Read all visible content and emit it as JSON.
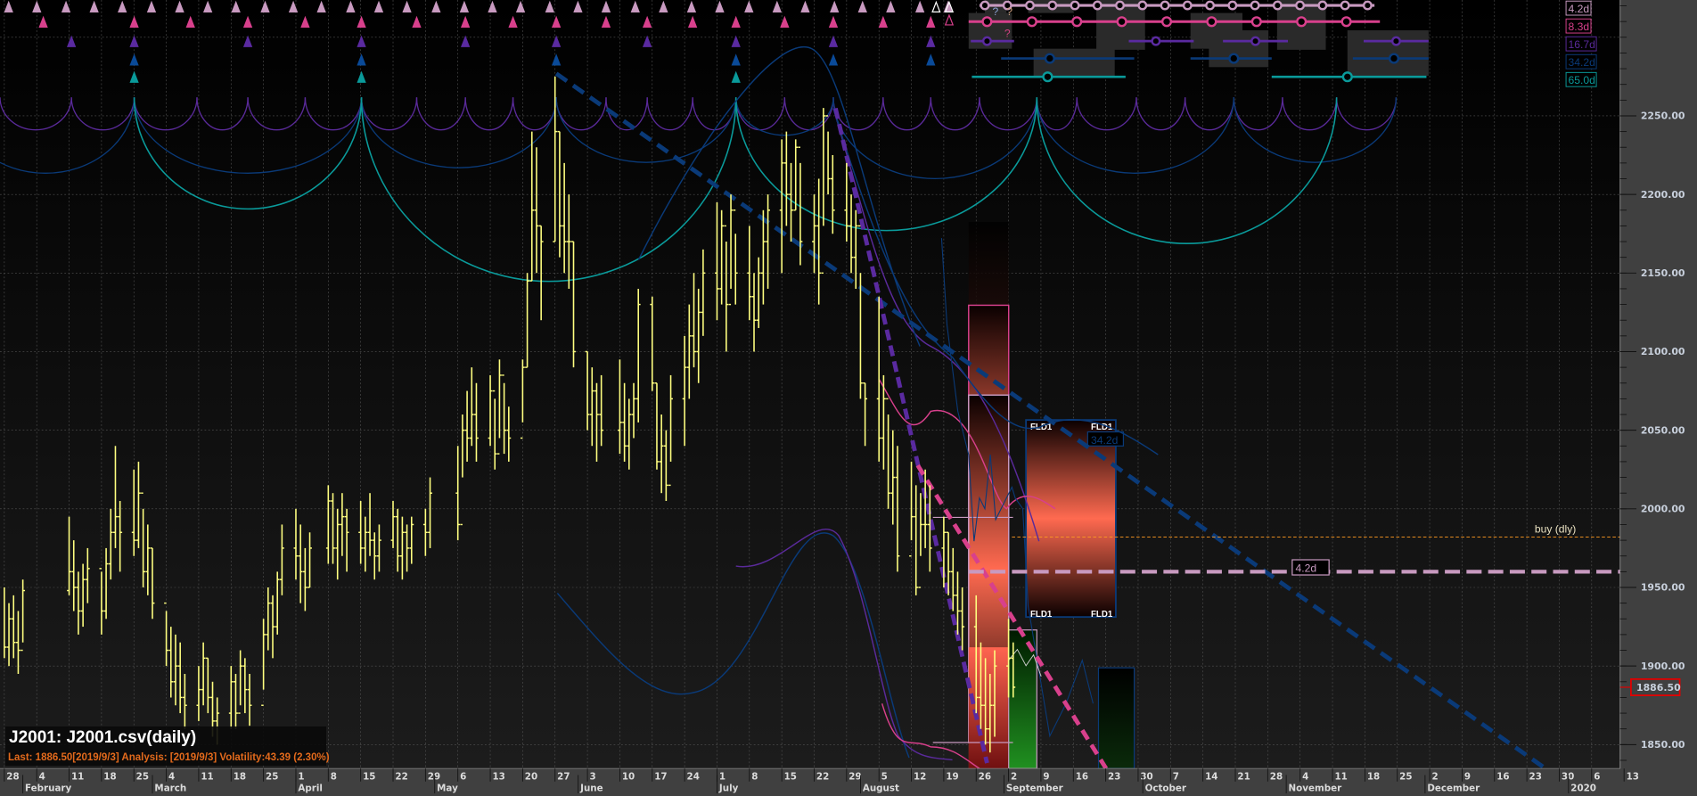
{
  "title": "J2001: J2001.csv(daily)",
  "status": "Last: 1886.50[2019/9/3] Analysis: [2019/9/3] Volatility:43.39 (2.30%)",
  "current_price": "1886.50",
  "cycles": [
    {
      "label": "4.2d",
      "color": "#c89ac0"
    },
    {
      "label": "8.3d",
      "color": "#d8408c"
    },
    {
      "label": "16.7d",
      "color": "#5a2a9a"
    },
    {
      "label": "34.2d",
      "color": "#0a3a78"
    },
    {
      "label": "65.0d",
      "color": "#0a9a9a"
    }
  ],
  "annotations": {
    "buy": "buy (dly)",
    "fld": "FLD1",
    "fld_period": "34.2d",
    "hline_period": "4.2d",
    "question": "?"
  },
  "colors": {
    "price": "#ffff80",
    "buy_line": "#ff9a20",
    "current_price_box": "#e00000"
  },
  "chart_data": {
    "type": "ohlc",
    "start_date": "2019-01-28",
    "ylim": [
      1836,
      2324
    ],
    "y_ticks": [
      "2250.00",
      "2200.00",
      "2150.00",
      "2100.00",
      "2050.00",
      "2000.00",
      "1950.00",
      "1900.00",
      "1850.00"
    ],
    "y_tick_values": [
      2250,
      2200,
      2150,
      2100,
      2050,
      2000,
      1950,
      1900,
      1850
    ],
    "x_ticks": [
      "28",
      "4",
      "11",
      "18",
      "25",
      "4",
      "11",
      "18",
      "25",
      "1",
      "8",
      "15",
      "22",
      "29",
      "6",
      "13",
      "20",
      "27",
      "3",
      "10",
      "17",
      "24",
      "1",
      "8",
      "15",
      "22",
      "29",
      "5",
      "12",
      "19",
      "26",
      "2",
      "9",
      "16",
      "23",
      "30",
      "7",
      "14",
      "21",
      "28",
      "4",
      "11",
      "18",
      "25",
      "2",
      "9",
      "16",
      "23",
      "30",
      "6",
      "13"
    ],
    "months": [
      {
        "label": "February",
        "day": 4
      },
      {
        "label": "March",
        "day": 32
      },
      {
        "label": "April",
        "day": 63
      },
      {
        "label": "May",
        "day": 93
      },
      {
        "label": "June",
        "day": 124
      },
      {
        "label": "July",
        "day": 154
      },
      {
        "label": "August",
        "day": 185
      },
      {
        "label": "September",
        "day": 216
      },
      {
        "label": "October",
        "day": 246
      },
      {
        "label": "November",
        "day": 277
      },
      {
        "label": "December",
        "day": 307
      },
      {
        "label": "2020",
        "day": 338
      }
    ],
    "last_price": 1886.5,
    "buy_level": 1982,
    "hline_level": 1960,
    "bars": [
      [
        0,
        1950,
        1905,
        1912
      ],
      [
        1,
        1940,
        1900,
        1930
      ],
      [
        2,
        1945,
        1905,
        1915
      ],
      [
        3,
        1935,
        1895,
        1910
      ],
      [
        4,
        1955,
        1915,
        1948
      ],
      [
        14,
        1995,
        1945,
        1960
      ],
      [
        15,
        1980,
        1935,
        1950
      ],
      [
        16,
        1960,
        1920,
        1935
      ],
      [
        17,
        1965,
        1925,
        1955
      ],
      [
        18,
        1975,
        1940,
        1962
      ],
      [
        21,
        1960,
        1920,
        1935
      ],
      [
        22,
        1975,
        1930,
        1965
      ],
      [
        23,
        2000,
        1955,
        1985
      ],
      [
        24,
        2040,
        1975,
        1995
      ],
      [
        25,
        2005,
        1960,
        1985
      ],
      [
        28,
        2025,
        1970,
        1980
      ],
      [
        29,
        2030,
        1975,
        2010
      ],
      [
        30,
        2000,
        1950,
        1960
      ],
      [
        31,
        1990,
        1945,
        1975
      ],
      [
        32,
        1975,
        1930,
        1940
      ],
      [
        35,
        1935,
        1900,
        1910
      ],
      [
        36,
        1925,
        1880,
        1890
      ],
      [
        37,
        1920,
        1875,
        1900
      ],
      [
        38,
        1915,
        1870,
        1880
      ],
      [
        39,
        1895,
        1860,
        1875
      ],
      [
        42,
        1900,
        1865,
        1885
      ],
      [
        43,
        1915,
        1875,
        1905
      ],
      [
        44,
        1905,
        1870,
        1880
      ],
      [
        45,
        1890,
        1855,
        1865
      ],
      [
        46,
        1880,
        1850,
        1870
      ],
      [
        49,
        1900,
        1860,
        1890
      ],
      [
        50,
        1895,
        1860,
        1870
      ],
      [
        51,
        1910,
        1875,
        1900
      ],
      [
        52,
        1905,
        1870,
        1885
      ],
      [
        53,
        1895,
        1862,
        1875
      ],
      [
        56,
        1930,
        1885,
        1920
      ],
      [
        57,
        1950,
        1910,
        1940
      ],
      [
        58,
        1945,
        1905,
        1925
      ],
      [
        59,
        1960,
        1920,
        1955
      ],
      [
        60,
        1990,
        1945,
        1975
      ],
      [
        63,
        2000,
        1955,
        1970
      ],
      [
        64,
        1990,
        1940,
        1960
      ],
      [
        65,
        1975,
        1935,
        1950
      ],
      [
        66,
        1985,
        1950,
        1975
      ],
      [
        70,
        2015,
        1965,
        2005
      ],
      [
        71,
        2010,
        1965,
        1975
      ],
      [
        72,
        2000,
        1955,
        1990
      ],
      [
        73,
        2010,
        1970,
        1995
      ],
      [
        74,
        2000,
        1960,
        1985
      ],
      [
        77,
        2005,
        1965,
        1975
      ],
      [
        78,
        1995,
        1960,
        1985
      ],
      [
        79,
        2010,
        1970,
        1980
      ],
      [
        80,
        1985,
        1955,
        1970
      ],
      [
        81,
        1990,
        1960,
        1980
      ],
      [
        84,
        2005,
        1975,
        1995
      ],
      [
        85,
        2000,
        1960,
        1970
      ],
      [
        86,
        1995,
        1955,
        1985
      ],
      [
        87,
        1990,
        1960,
        1975
      ],
      [
        88,
        1995,
        1965,
        1990
      ],
      [
        91,
        2000,
        1970,
        1985
      ],
      [
        92,
        2020,
        1975,
        2010
      ],
      [
        98,
        2040,
        1980,
        1990
      ],
      [
        99,
        2060,
        2020,
        2050
      ],
      [
        100,
        2075,
        2030,
        2045
      ],
      [
        101,
        2090,
        2040,
        2060
      ],
      [
        102,
        2080,
        2030,
        2045
      ],
      [
        105,
        2085,
        2040,
        2075
      ],
      [
        106,
        2070,
        2025,
        2035
      ],
      [
        107,
        2095,
        2045,
        2085
      ],
      [
        108,
        2080,
        2035,
        2050
      ],
      [
        109,
        2065,
        2030,
        2045
      ],
      [
        112,
        2095,
        2055,
        2090
      ],
      [
        113,
        2150,
        2090,
        2145
      ],
      [
        114,
        2240,
        2145,
        2190
      ],
      [
        115,
        2230,
        2150,
        2180
      ],
      [
        116,
        2180,
        2120,
        2170
      ],
      [
        119,
        2275,
        2170,
        2240
      ],
      [
        120,
        2240,
        2160,
        2180
      ],
      [
        121,
        2220,
        2150,
        2170
      ],
      [
        122,
        2200,
        2140,
        2170
      ],
      [
        123,
        2170,
        2090,
        2100
      ],
      [
        126,
        2100,
        2050,
        2060
      ],
      [
        127,
        2090,
        2040,
        2075
      ],
      [
        128,
        2080,
        2030,
        2060
      ],
      [
        129,
        2085,
        2040,
        2050
      ],
      [
        133,
        2095,
        2035,
        2055
      ],
      [
        134,
        2080,
        2030,
        2040
      ],
      [
        135,
        2070,
        2025,
        2060
      ],
      [
        136,
        2080,
        2045,
        2070
      ],
      [
        137,
        2140,
        2055,
        2130
      ],
      [
        140,
        2135,
        2075,
        2080
      ],
      [
        141,
        2080,
        2025,
        2030
      ],
      [
        142,
        2060,
        2010,
        2040
      ],
      [
        143,
        2050,
        2005,
        2015
      ],
      [
        144,
        2085,
        2030,
        2070
      ],
      [
        147,
        2110,
        2040,
        2090
      ],
      [
        148,
        2130,
        2070,
        2110
      ],
      [
        149,
        2150,
        2090,
        2100
      ],
      [
        150,
        2140,
        2080,
        2125
      ],
      [
        151,
        2165,
        2110,
        2150
      ],
      [
        154,
        2195,
        2120,
        2140
      ],
      [
        155,
        2190,
        2130,
        2180
      ],
      [
        156,
        2170,
        2100,
        2130
      ],
      [
        157,
        2200,
        2140,
        2190
      ],
      [
        158,
        2175,
        2130,
        2150
      ],
      [
        161,
        2180,
        2120,
        2135
      ],
      [
        162,
        2150,
        2100,
        2120
      ],
      [
        163,
        2160,
        2115,
        2150
      ],
      [
        164,
        2190,
        2130,
        2170
      ],
      [
        165,
        2200,
        2140,
        2190
      ],
      [
        168,
        2235,
        2150,
        2220
      ],
      [
        169,
        2240,
        2180,
        2200
      ],
      [
        170,
        2220,
        2170,
        2190
      ],
      [
        171,
        2235,
        2190,
        2230
      ],
      [
        172,
        2220,
        2155,
        2170
      ],
      [
        175,
        2200,
        2150,
        2180
      ],
      [
        176,
        2210,
        2130,
        2150
      ],
      [
        177,
        2255,
        2180,
        2250
      ],
      [
        178,
        2240,
        2200,
        2210
      ],
      [
        179,
        2225,
        2175,
        2190
      ],
      [
        182,
        2220,
        2170,
        2180
      ],
      [
        183,
        2200,
        2150,
        2160
      ],
      [
        184,
        2190,
        2140,
        2180
      ],
      [
        185,
        2150,
        2070,
        2080
      ],
      [
        186,
        2080,
        2040,
        2070
      ],
      [
        189,
        2135,
        2030,
        2045
      ],
      [
        190,
        2085,
        2025,
        2070
      ],
      [
        191,
        2060,
        2000,
        2010
      ],
      [
        192,
        2050,
        1990,
        2020
      ],
      [
        193,
        2040,
        1960,
        1970
      ],
      [
        196,
        2030,
        1980,
        1995
      ],
      [
        197,
        2015,
        1945,
        1950
      ],
      [
        198,
        2010,
        1970,
        1990
      ],
      [
        199,
        2025,
        1975,
        1990
      ],
      [
        200,
        2015,
        1960,
        1975
      ],
      [
        203,
        1995,
        1950,
        1985
      ],
      [
        204,
        1985,
        1945,
        1960
      ],
      [
        205,
        1975,
        1935,
        1945
      ],
      [
        206,
        1960,
        1920,
        1935
      ],
      [
        207,
        1950,
        1910,
        1925
      ],
      [
        210,
        1945,
        1870,
        1880
      ],
      [
        211,
        1915,
        1860,
        1875
      ],
      [
        212,
        1905,
        1850,
        1860
      ],
      [
        213,
        1895,
        1845,
        1875
      ],
      [
        214,
        1910,
        1855,
        1900
      ],
      [
        217,
        1930,
        1880,
        1905
      ],
      [
        218,
        1915,
        1880,
        1886.5
      ]
    ]
  }
}
